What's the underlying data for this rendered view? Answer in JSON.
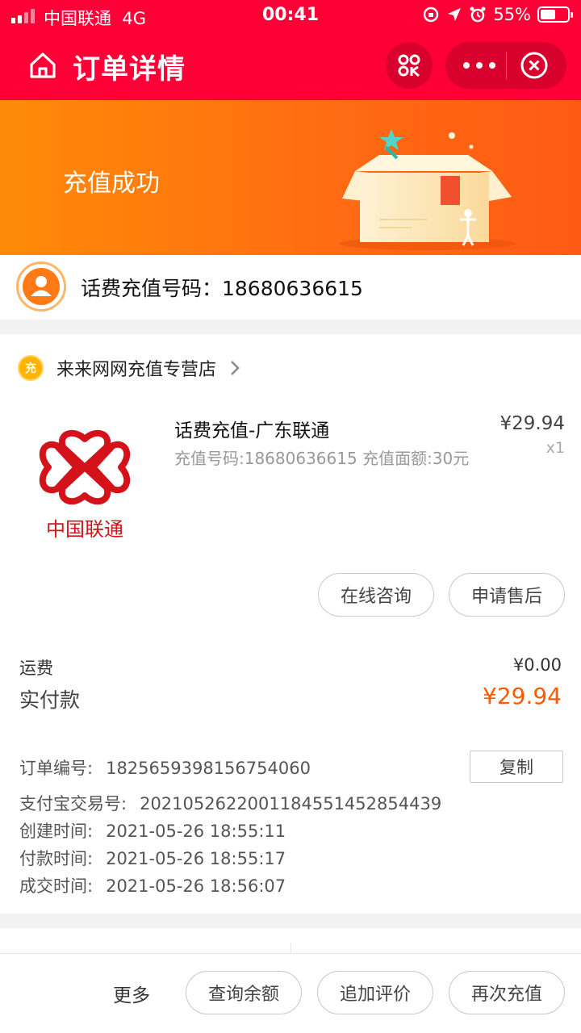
{
  "status_bar": {
    "carrier": "中国联通",
    "network": "4G",
    "time": "00:41",
    "battery": "55%",
    "battery_level": 0.55
  },
  "nav": {
    "title": "订单详情"
  },
  "banner": {
    "status": "充值成功"
  },
  "phone_row": {
    "text": "话费充值号码：18680636615"
  },
  "shop": {
    "logo_text": "充",
    "name": "来来网网充值专营店"
  },
  "product": {
    "brand": "中国联通",
    "title": "话费充值-广东联通",
    "desc": "充值号码:18680636615 充值面额:30元",
    "price": "¥29.94",
    "qty": "x1"
  },
  "actions": {
    "consult": "在线咨询",
    "after_sale": "申请售后"
  },
  "payment": {
    "fee_label": "运费",
    "fee_value": "¥0.00",
    "paid_label": "实付款",
    "paid_value": "¥29.94"
  },
  "order_info": {
    "order_no_label": "订单编号:",
    "order_no": "1825659398156754060",
    "copy": "复制",
    "alipay_label": "支付宝交易号:",
    "alipay_no": "2021052622001184551452854439",
    "created_label": "创建时间:",
    "created": "2021-05-26 18:55:11",
    "paid_label": "付款时间:",
    "paid": "2021-05-26 18:55:17",
    "closed_label": "成交时间:",
    "closed": "2021-05-26 18:56:07"
  },
  "bottom_bar": {
    "more": "更多",
    "query_balance": "查询余额",
    "add_review": "追加评价",
    "recharge_again": "再次充值"
  },
  "colors": {
    "brand_red": "#fe0036",
    "banner_orange": "#ff7a12",
    "price_orange": "#ff5a00",
    "unicom_red": "#d4121a"
  }
}
